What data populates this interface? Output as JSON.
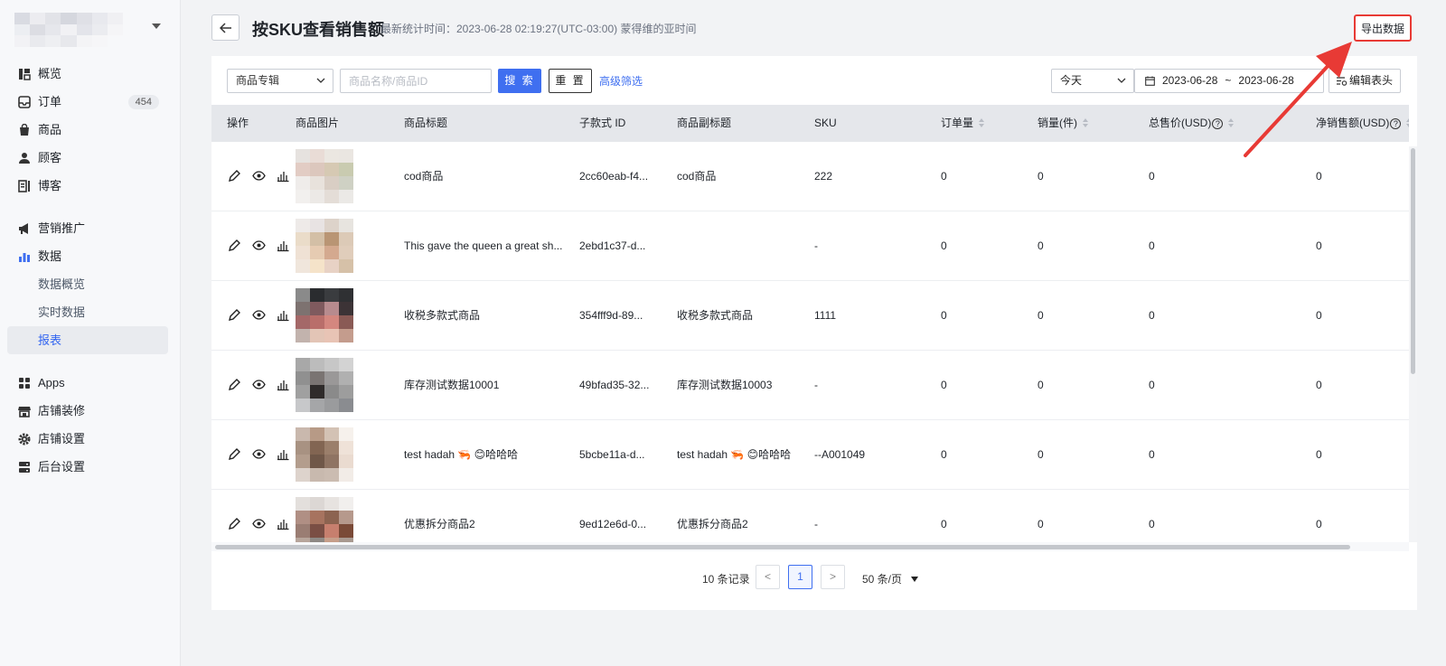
{
  "sidebar": {
    "badge_orders": "454",
    "items": [
      {
        "label": "概览",
        "icon": "overview-icon"
      },
      {
        "label": "订单",
        "icon": "inbox-icon"
      },
      {
        "label": "商品",
        "icon": "bag-icon"
      },
      {
        "label": "顾客",
        "icon": "user-icon"
      },
      {
        "label": "博客",
        "icon": "blog-icon"
      },
      {
        "label": "营销推广",
        "icon": "megaphone-icon"
      },
      {
        "label": "数据",
        "icon": "bar-chart-icon"
      },
      {
        "label": "数据概览"
      },
      {
        "label": "实时数据"
      },
      {
        "label": "报表"
      },
      {
        "label": "Apps",
        "icon": "apps-icon"
      },
      {
        "label": "店铺装修",
        "icon": "store-icon"
      },
      {
        "label": "店铺设置",
        "icon": "gear-icon"
      },
      {
        "label": "后台设置",
        "icon": "server-icon"
      }
    ]
  },
  "header": {
    "title": "按SKU查看销售额",
    "stat_time": "最新统计时间：2023-06-28 02:19:27(UTC-03:00) 蒙得维的亚时间",
    "export_label": "导出数据"
  },
  "filters": {
    "album_select": "商品专辑",
    "search_placeholder": "商品名称/商品ID",
    "search_label": "搜 索",
    "reset_label": "重 置",
    "advanced_label": "高级筛选",
    "day_select": "今天",
    "date_start": "2023-06-28",
    "date_sep": "~",
    "date_end": "2023-06-28",
    "edit_header_label": "编辑表头"
  },
  "table": {
    "headers": {
      "ops": "操作",
      "image": "商品图片",
      "title": "商品标题",
      "variant_id": "子款式 ID",
      "subtitle": "商品副标题",
      "sku": "SKU",
      "orders": "订单量",
      "sales": "销量(件)",
      "gross": "总售价(USD)",
      "net": "净销售额(USD)"
    },
    "rows": [
      {
        "title": "cod商品",
        "variant_id": "2cc60eab-f4...",
        "subtitle": "cod商品",
        "sku": "222",
        "orders": "0",
        "sales": "0",
        "gross": "0",
        "net": "0"
      },
      {
        "title": "This gave the queen a great sh...",
        "variant_id": "2ebd1c37-d...",
        "subtitle": "",
        "sku": "-",
        "orders": "0",
        "sales": "0",
        "gross": "0",
        "net": "0"
      },
      {
        "title": "收税多款式商品",
        "variant_id": "354fff9d-89...",
        "subtitle": "收税多款式商品",
        "sku": "1111",
        "orders": "0",
        "sales": "0",
        "gross": "0",
        "net": "0"
      },
      {
        "title": "库存测试数据10001",
        "variant_id": "49bfad35-32...",
        "subtitle": "库存测试数据10003",
        "sku": "-",
        "orders": "0",
        "sales": "0",
        "gross": "0",
        "net": "0"
      },
      {
        "title": "test hadah 🦐 😊哈哈哈",
        "variant_id": "5bcbe11a-d...",
        "subtitle": "test hadah 🦐 😊哈哈哈",
        "sku": "--A001049",
        "orders": "0",
        "sales": "0",
        "gross": "0",
        "net": "0"
      },
      {
        "title": "优惠拆分商品2",
        "variant_id": "9ed12e6d-0...",
        "subtitle": "优惠拆分商品2",
        "sku": "-",
        "orders": "0",
        "sales": "0",
        "gross": "0",
        "net": "0"
      }
    ]
  },
  "pagination": {
    "total": "10 条记录",
    "prev": "<",
    "current": "1",
    "next": ">",
    "per_page": "50 条/页"
  },
  "colors": {
    "accent": "#3f6ff0",
    "annotation": "#e83a35"
  }
}
